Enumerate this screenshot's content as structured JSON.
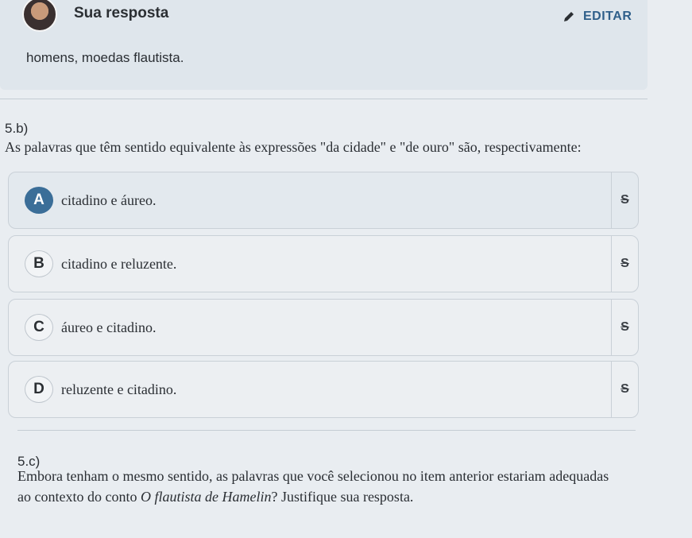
{
  "answer": {
    "title": "Sua resposta",
    "edit_label": "EDITAR",
    "text": "homens, moedas  flautista."
  },
  "q5b": {
    "number": "5.b)",
    "prompt": "As palavras que têm sentido equivalente às expressões \"da cidade\" e \"de ouro\" são, respectivamente:",
    "options": [
      {
        "letter": "A",
        "text": "citadino e áureo.",
        "strike": "S"
      },
      {
        "letter": "B",
        "text": "citadino e reluzente.",
        "strike": "S"
      },
      {
        "letter": "C",
        "text": "áureo e citadino.",
        "strike": "S"
      },
      {
        "letter": "D",
        "text": "reluzente e citadino.",
        "strike": "S"
      }
    ]
  },
  "q5c": {
    "number": "5.c)",
    "prompt_part1": "Embora tenham o mesmo sentido, as palavras que você selecionou no item anterior estariam adequadas",
    "prompt_part2_pre": "ao contexto do conto ",
    "prompt_part2_title": "O flautista de Hamelin",
    "prompt_part2_post": "? Justifique sua resposta."
  },
  "colors": {
    "accent": "#3b6e98",
    "edit_link": "#2f5f8a"
  },
  "icons": [
    "avatar",
    "pencil-icon",
    "strikethrough-icon"
  ]
}
